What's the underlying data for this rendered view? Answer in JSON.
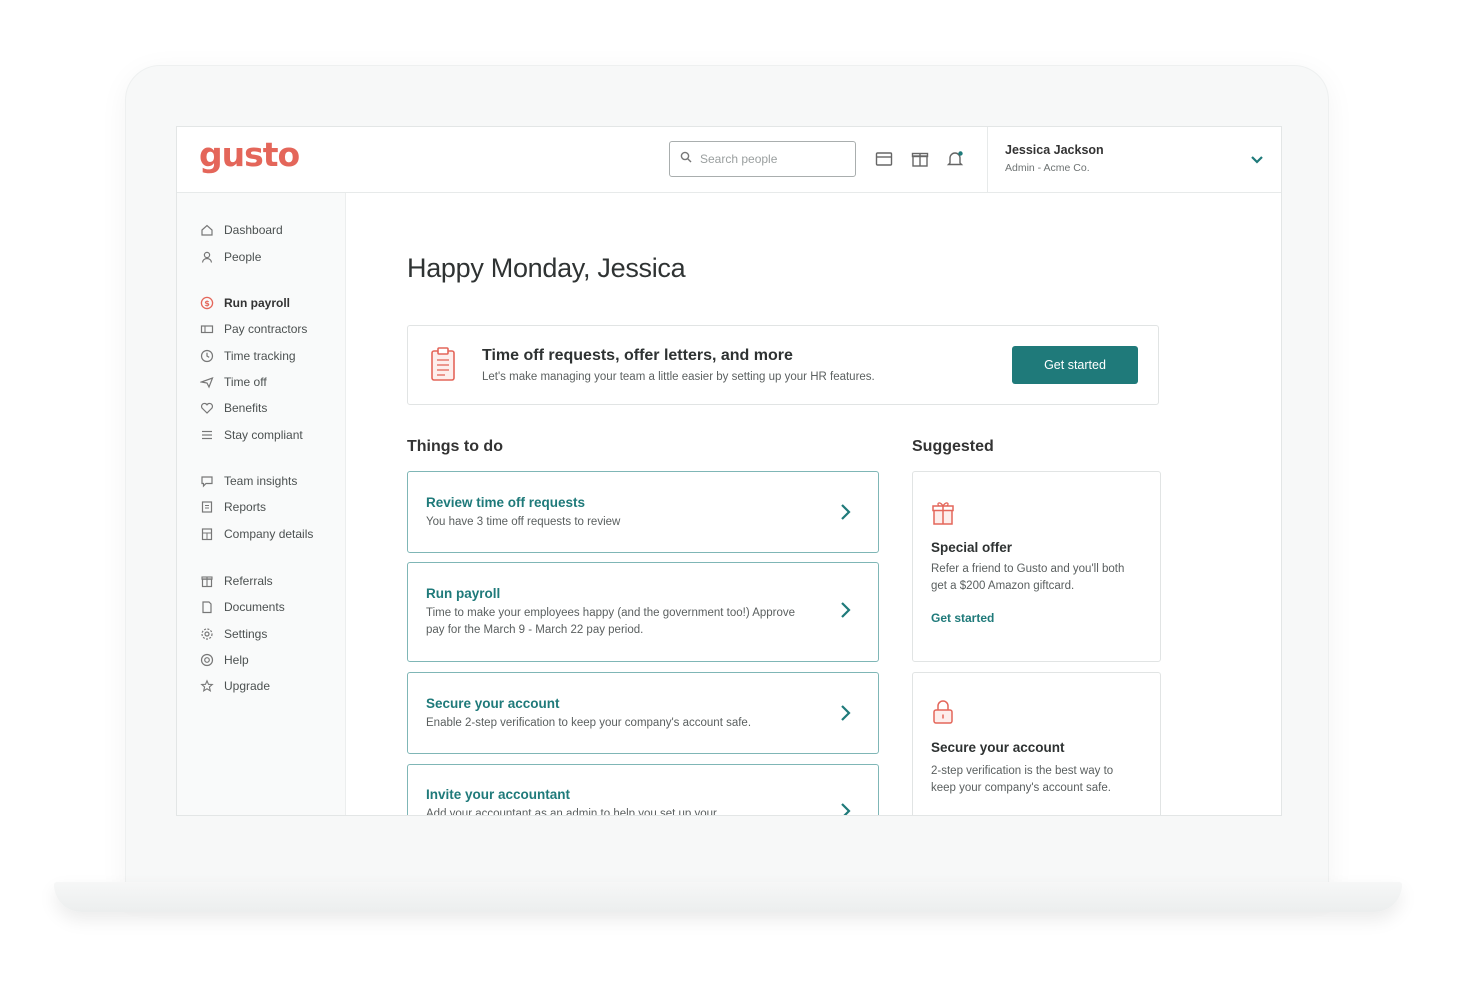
{
  "brand": {
    "logo": "gusto",
    "accent": "#e4665a",
    "teal": "#1f7a7a"
  },
  "header": {
    "search_placeholder": "Search people",
    "icons": [
      "search-icon",
      "calendar-icon",
      "gift-icon",
      "bell-icon",
      "chevron-down-icon"
    ],
    "user": {
      "name": "Jessica Jackson",
      "role": "Admin - Acme Co."
    }
  },
  "sidebar": {
    "items": [
      {
        "label": "Dashboard",
        "icon": "home-icon"
      },
      {
        "label": "People",
        "icon": "people-icon"
      },
      {
        "label": "Run payroll",
        "icon": "dollar-icon"
      },
      {
        "label": "Pay contractors",
        "icon": "card-icon"
      },
      {
        "label": "Time tracking",
        "icon": "clock-icon"
      },
      {
        "label": "Time off",
        "icon": "plane-icon"
      },
      {
        "label": "Benefits",
        "icon": "heart-icon"
      },
      {
        "label": "Stay compliant",
        "icon": "list-icon"
      },
      {
        "label": "Team insights",
        "icon": "chat-icon"
      },
      {
        "label": "Reports",
        "icon": "report-icon"
      },
      {
        "label": "Company details",
        "icon": "building-icon"
      },
      {
        "label": "Referrals",
        "icon": "gift-icon"
      },
      {
        "label": "Documents",
        "icon": "document-icon"
      },
      {
        "label": "Settings",
        "icon": "gear-icon"
      },
      {
        "label": "Help",
        "icon": "help-icon"
      },
      {
        "label": "Upgrade",
        "icon": "star-icon"
      }
    ]
  },
  "main": {
    "greeting": "Happy Monday, Jessica",
    "banner": {
      "title": "Time off requests, offer letters, and more",
      "subtitle": "Let's make managing your team a little easier by setting up your HR features.",
      "button": "Get started"
    },
    "todo_title": "Things to do",
    "todos": [
      {
        "title": "Review time off requests",
        "desc": "You have 3 time off requests to review"
      },
      {
        "title": "Run payroll",
        "desc": "Time to make your employees happy (and the government too!) Approve pay for the March 9 - March 22 pay period."
      },
      {
        "title": "Secure your account",
        "desc": "Enable 2-step verification to keep your company's account safe."
      },
      {
        "title": "Invite your accountant",
        "desc": "Add your accountant as an admin to help you set up your"
      }
    ],
    "suggested_title": "Suggested",
    "suggested": [
      {
        "title": "Special offer",
        "desc": "Refer a friend to Gusto and you'll both get a $200 Amazon giftcard.",
        "link": "Get started",
        "icon": "gift-icon"
      },
      {
        "title": "Secure your account",
        "desc": "2-step verification is the best way to keep your company's account safe.",
        "icon": "lock-icon"
      }
    ]
  }
}
